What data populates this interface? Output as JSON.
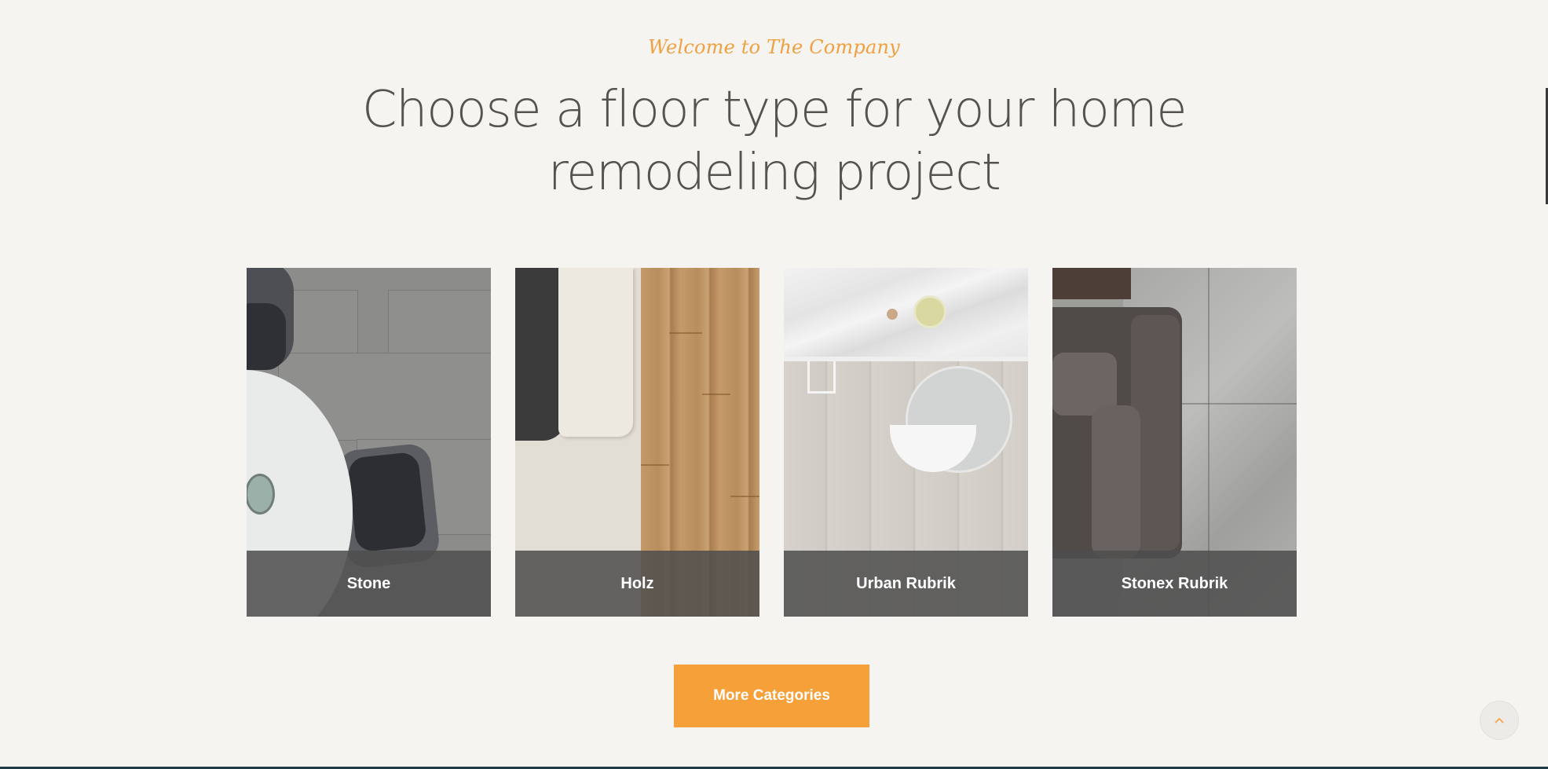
{
  "section": {
    "tagline": "Welcome to The Company",
    "heading": "Choose a floor type for your home remodeling project"
  },
  "cards": [
    {
      "label": "Stone"
    },
    {
      "label": "Holz"
    },
    {
      "label": "Urban Rubrik"
    },
    {
      "label": "Stonex Rubrik"
    }
  ],
  "cta": {
    "label": "More Categories"
  },
  "scroll_top": {
    "icon": "chevron-up-icon"
  },
  "colors": {
    "accent": "#f6a03a",
    "background": "#f5f4f1",
    "heading": "#55534f",
    "caption_overlay": "#4e4e4e"
  }
}
